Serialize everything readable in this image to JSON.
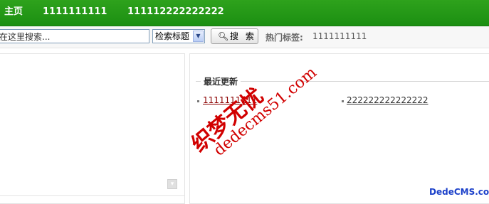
{
  "nav": {
    "home": "主页",
    "item1": "1111111111",
    "item2": "111112222222222"
  },
  "search": {
    "placeholder": "在这里搜索...",
    "value": "在这里搜索...",
    "select_value": "检索标题",
    "button_label": "搜 索",
    "hot_label": "热门标签:",
    "hot_value": "1111111111"
  },
  "recent": {
    "title": "最近更新",
    "items": [
      "1111111111",
      "222222222222222"
    ]
  },
  "watermark": {
    "chinese": "织梦无忧",
    "url": "dedecms51.com",
    "brand": "DedeCMS.com"
  },
  "colors": {
    "nav_green": "#2ea21c",
    "watermark_red": "#d10000",
    "brand_blue": "#1a3fc9"
  }
}
